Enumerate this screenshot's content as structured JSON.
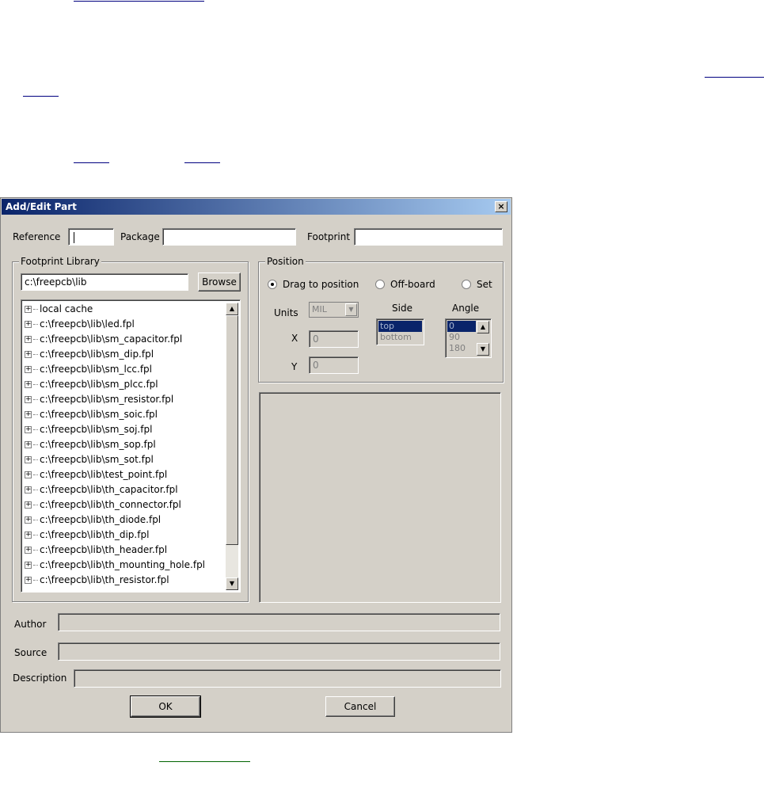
{
  "dialog": {
    "title": "Add/Edit Part",
    "close_glyph": "×",
    "reference": {
      "label": "Reference",
      "value": ""
    },
    "package": {
      "label": "Package",
      "value": ""
    },
    "footprint": {
      "label": "Footprint",
      "value": ""
    },
    "footprint_library": {
      "group_title": "Footprint Library",
      "path": "c:\\freepcb\\lib",
      "browse_label": "Browse",
      "items": [
        "local cache",
        "c:\\freepcb\\lib\\led.fpl",
        "c:\\freepcb\\lib\\sm_capacitor.fpl",
        "c:\\freepcb\\lib\\sm_dip.fpl",
        "c:\\freepcb\\lib\\sm_lcc.fpl",
        "c:\\freepcb\\lib\\sm_plcc.fpl",
        "c:\\freepcb\\lib\\sm_resistor.fpl",
        "c:\\freepcb\\lib\\sm_soic.fpl",
        "c:\\freepcb\\lib\\sm_soj.fpl",
        "c:\\freepcb\\lib\\sm_sop.fpl",
        "c:\\freepcb\\lib\\sm_sot.fpl",
        "c:\\freepcb\\lib\\test_point.fpl",
        "c:\\freepcb\\lib\\th_capacitor.fpl",
        "c:\\freepcb\\lib\\th_connector.fpl",
        "c:\\freepcb\\lib\\th_diode.fpl",
        "c:\\freepcb\\lib\\th_dip.fpl",
        "c:\\freepcb\\lib\\th_header.fpl",
        "c:\\freepcb\\lib\\th_mounting_hole.fpl",
        "c:\\freepcb\\lib\\th_resistor.fpl"
      ]
    },
    "position": {
      "group_title": "Position",
      "radios": {
        "drag": "Drag to position",
        "offboard": "Off-board",
        "set": "Set"
      },
      "units_label": "Units",
      "units_value": "MIL",
      "x_label": "X",
      "x_value": "0",
      "y_label": "Y",
      "y_value": "0",
      "side_label": "Side",
      "side_options": [
        "top",
        "bottom"
      ],
      "angle_label": "Angle",
      "angle_options": [
        "0",
        "90",
        "180"
      ]
    },
    "author_label": "Author",
    "source_label": "Source",
    "description_label": "Description",
    "ok_label": "OK",
    "cancel_label": "Cancel"
  },
  "glyphs": {
    "expander": "+",
    "scroll_up": "▲",
    "scroll_down": "▼",
    "dropdown": "▼"
  }
}
